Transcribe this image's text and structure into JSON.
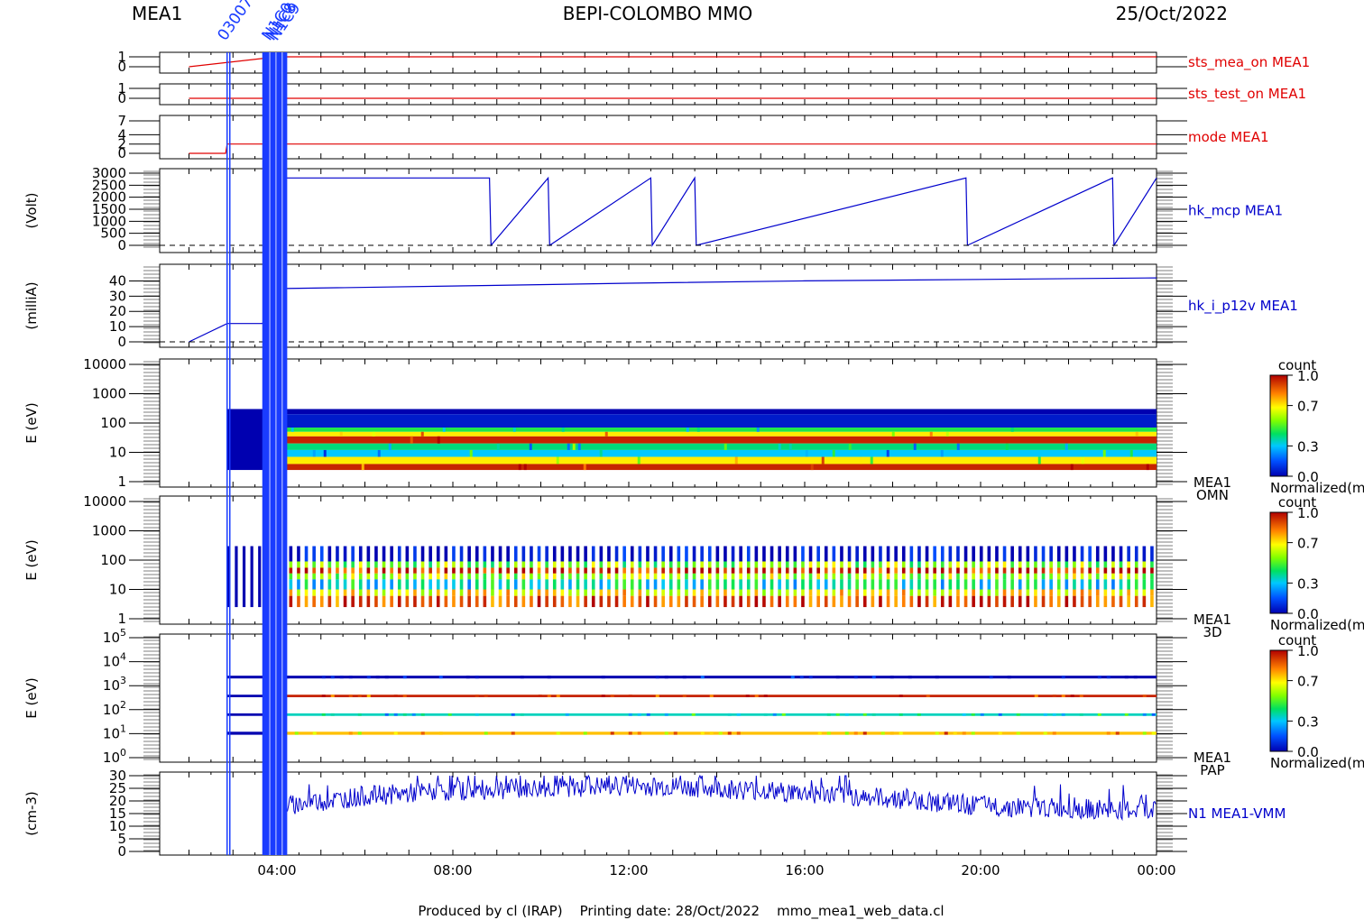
{
  "header": {
    "left": "MEA1",
    "center": "BEPI-COLOMBO MMO",
    "right": "25/Oct/2022"
  },
  "footer": "Produced by cl (IRAP)    Printing date: 28/Oct/2022    mmo_mea1_web_data.cl",
  "colors": {
    "red_trace": "#e00000",
    "blue_trace": "#0000cc",
    "marker_blue": "#1a3cff"
  },
  "chart_data": [
    {
      "type": "line",
      "label": "sts_mea_on MEA1",
      "ticks": [
        "1",
        "0"
      ],
      "ylim": [
        0,
        1
      ],
      "series": [
        {
          "name": "sts_mea_on MEA1",
          "x": [
            "02:00",
            "04:00",
            "00:00"
          ],
          "values": [
            0,
            1,
            1
          ]
        }
      ]
    },
    {
      "type": "line",
      "label": "sts_test_on MEA1",
      "ticks": [
        "1",
        "0"
      ],
      "ylim": [
        0,
        1
      ],
      "series": [
        {
          "name": "sts_test_on MEA1",
          "x": [
            "02:00",
            "00:00"
          ],
          "values": [
            0,
            0
          ]
        }
      ]
    },
    {
      "type": "line",
      "label": "mode MEA1",
      "ticks": [
        "7",
        "4",
        "2",
        "0"
      ],
      "ylim": [
        0,
        7
      ],
      "series": [
        {
          "name": "mode MEA1",
          "x": [
            "02:00",
            "02:50",
            "02:52",
            "00:00"
          ],
          "values": [
            0,
            0,
            2,
            2
          ]
        }
      ]
    },
    {
      "type": "line",
      "label": "hk_mcp MEA1",
      "ylabel": "(Volt)",
      "ticks": [
        "3000",
        "2500",
        "2000",
        "1500",
        "1000",
        "500",
        "0"
      ],
      "ylim": [
        0,
        3000
      ],
      "series": [
        {
          "name": "hk_mcp MEA1",
          "x": [
            "04:10",
            "08:50",
            "08:52",
            "10:10",
            "10:12",
            "12:30",
            "12:32",
            "13:30",
            "13:32",
            "19:40",
            "19:42",
            "23:00",
            "23:02",
            "00:00"
          ],
          "values": [
            2800,
            2800,
            0,
            2800,
            0,
            2800,
            0,
            2800,
            0,
            2800,
            0,
            2800,
            0,
            2800
          ]
        }
      ]
    },
    {
      "type": "line",
      "label": "hk_i_p12v MEA1",
      "ylabel": "(milliA)",
      "ticks": [
        "40",
        "30",
        "20",
        "10",
        "0"
      ],
      "ylim": [
        0,
        45
      ],
      "series": [
        {
          "name": "hk_i_p12v MEA1",
          "x": [
            "02:00",
            "02:52",
            "03:40",
            "04:10",
            "08:50",
            "12:00",
            "16:00",
            "20:00",
            "00:00"
          ],
          "values": [
            0,
            12,
            12,
            35,
            37,
            38.5,
            40,
            41,
            42
          ]
        }
      ]
    },
    {
      "type": "heatmap",
      "label": "MEA1 OMN",
      "ylabel": "E (eV)",
      "ticks": [
        "10000",
        "1000",
        "100",
        "10",
        "1"
      ],
      "ylim": [
        1,
        10000
      ],
      "colorbar": {
        "title": "count",
        "ticks": [
          "1.0",
          "0.7",
          "0.3",
          "0.0"
        ],
        "label": "Normalized(m"
      },
      "bands": [
        {
          "e_range": [
            200,
            300
          ],
          "level": 0.0
        },
        {
          "e_range": [
            70,
            200
          ],
          "level": 0.05
        },
        {
          "e_range": [
            50,
            70
          ],
          "level": 0.45
        },
        {
          "e_range": [
            35,
            50
          ],
          "level": 0.7
        },
        {
          "e_range": [
            20,
            35
          ],
          "level": 0.95
        },
        {
          "e_range": [
            12,
            20
          ],
          "level": 0.4
        },
        {
          "e_range": [
            7,
            12
          ],
          "level": 0.3
        },
        {
          "e_range": [
            4,
            7
          ],
          "level": 0.7
        },
        {
          "e_range": [
            2.5,
            4
          ],
          "level": 0.95
        }
      ]
    },
    {
      "type": "heatmap",
      "label": "MEA1 3D",
      "ylabel": "E (eV)",
      "ticks": [
        "10000",
        "1000",
        "100",
        "10",
        "1"
      ],
      "ylim": [
        1,
        10000
      ],
      "colorbar": {
        "title": "count",
        "ticks": [
          "1.0",
          "0.7",
          "0.3",
          "0.0"
        ],
        "label": "Normalized(m"
      },
      "bands": [
        {
          "e_range": [
            90,
            300
          ],
          "level": 0.0
        },
        {
          "e_range": [
            55,
            90
          ],
          "level": 0.55
        },
        {
          "e_range": [
            35,
            55
          ],
          "level": 0.95
        },
        {
          "e_range": [
            22,
            35
          ],
          "level": 0.6
        },
        {
          "e_range": [
            10,
            22
          ],
          "level": 0.35
        },
        {
          "e_range": [
            6,
            10
          ],
          "level": 0.7
        },
        {
          "e_range": [
            2.5,
            6
          ],
          "level": 0.9
        }
      ]
    },
    {
      "type": "heatmap",
      "label": "MEA1 PAP",
      "ylabel": "E (eV)",
      "ticks": [
        "10^5",
        "10^4",
        "10^3",
        "10^2",
        "10^1",
        "10^0"
      ],
      "ylim": [
        1,
        100000
      ],
      "colorbar": {
        "title": "count",
        "ticks": [
          "1.0",
          "0.7",
          "0.3",
          "0.0"
        ],
        "label": "Normalized(m"
      },
      "bands": [
        {
          "e_range": [
            2000,
            2600
          ],
          "level": 0.0
        },
        {
          "e_range": [
            330,
            420
          ],
          "level": 0.95
        },
        {
          "e_range": [
            55,
            70
          ],
          "level": 0.35
        },
        {
          "e_range": [
            9,
            12
          ],
          "level": 0.75
        }
      ]
    },
    {
      "type": "line",
      "label": "N1 MEA1-VMM",
      "ylabel": "(cm-3)",
      "ticks": [
        "30",
        "25",
        "20",
        "15",
        "10",
        "5",
        "0"
      ],
      "ylim": [
        0,
        30
      ],
      "series": [
        {
          "name": "N1 MEA1-VMM",
          "x": [
            "04:10",
            "06:00",
            "08:00",
            "10:00",
            "12:00",
            "14:00",
            "16:00",
            "18:00",
            "20:00",
            "22:00",
            "00:00"
          ],
          "values": [
            18,
            22,
            24,
            25,
            26,
            25,
            23,
            21,
            18,
            17,
            16
          ]
        }
      ]
    }
  ],
  "xaxis": {
    "ticks": [
      "04:00",
      "08:00",
      "12:00",
      "16:00",
      "20:00",
      "00:00"
    ],
    "range": [
      "01:20",
      "00:00"
    ]
  },
  "markers": {
    "labels": [
      "03007",
      "N1C0",
      "N1C8",
      "N1C9"
    ]
  }
}
